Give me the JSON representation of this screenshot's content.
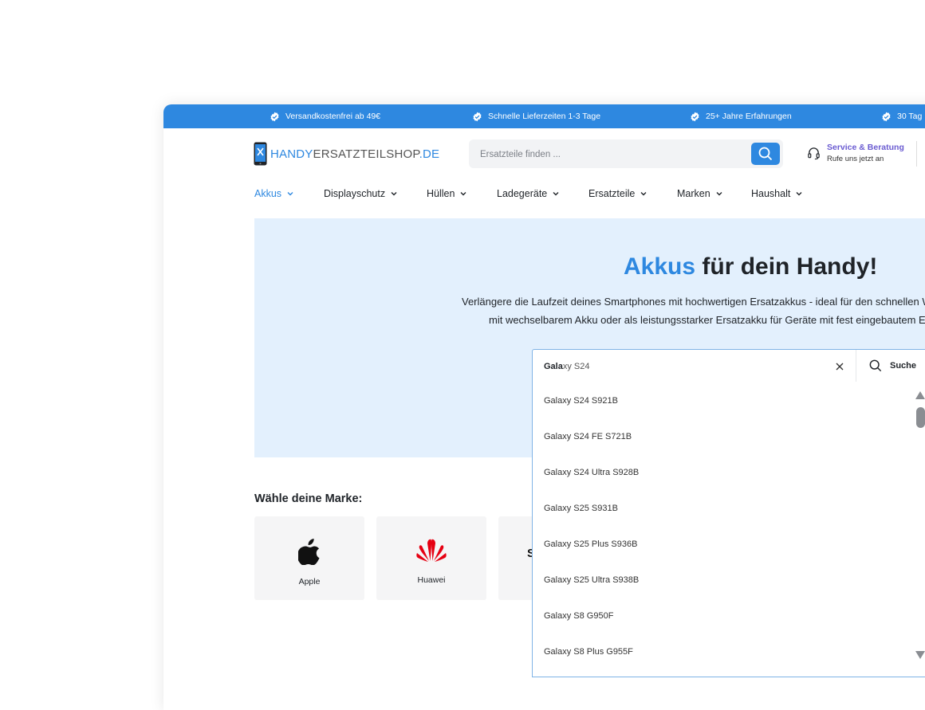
{
  "topbar": {
    "items": [
      "Versandkostenfrei ab 49€",
      "Schnelle Lieferzeiten 1-3 Tage",
      "25+ Jahre Erfahrungen",
      "30 Tag"
    ]
  },
  "logo": {
    "part1": "HANDY",
    "part2": "ERSATZTEILSHOP",
    "part3": ".DE"
  },
  "search": {
    "placeholder": "Ersatzteile finden ..."
  },
  "service": {
    "title": "Service & Beratung",
    "subtitle": "Rufe uns jetzt an"
  },
  "nav": {
    "items": [
      "Akkus",
      "Displayschutz",
      "Hüllen",
      "Ladegeräte",
      "Ersatzteile",
      "Marken",
      "Haushalt"
    ]
  },
  "hero": {
    "title_accent": "Akkus",
    "title_rest": " für dein Handy!",
    "line1": "Verlängere die Laufzeit deines Smartphones mit hochwertigen Ersatzakkus - ideal für den schnellen W",
    "line2": "mit wechselbarem Akku oder als leistungsstarker Ersatzakku für Geräte mit fest eingebautem En"
  },
  "brands": {
    "heading": "Wähle deine Marke:",
    "items": [
      "Apple",
      "Huawei"
    ]
  },
  "dropdown": {
    "query_typed": "Gala",
    "query_suggest": "xy S24",
    "search_label": "Suche",
    "results": [
      "Galaxy S24 S921B",
      "Galaxy S24 FE S721B",
      "Galaxy S24 Ultra S928B",
      "Galaxy S25 S931B",
      "Galaxy S25 Plus S936B",
      "Galaxy S25 Ultra S938B",
      "Galaxy S8 G950F",
      "Galaxy S8 Plus G955F"
    ]
  },
  "colors": {
    "brand_blue": "#2e88e0",
    "hero_bg": "#e3f0fd",
    "huawei_red": "#e60012"
  }
}
